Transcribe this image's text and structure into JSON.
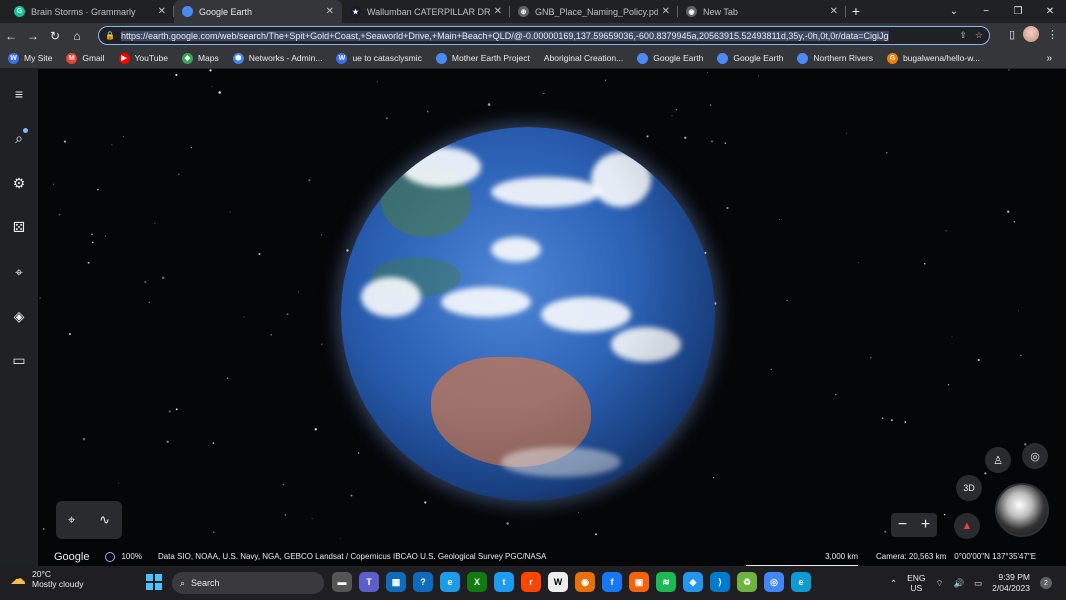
{
  "tabs": [
    {
      "title": "Brain Storms · Grammarly",
      "favicon_color": "#15c39a",
      "favicon_char": "G"
    },
    {
      "title": "Google Earth",
      "favicon_color": "#4a8af4",
      "favicon_char": "",
      "active": true
    },
    {
      "title": "Wallumban CATERPILLAR DREAM",
      "favicon_color": "#1a1a2e",
      "favicon_char": "★"
    },
    {
      "title": "GNB_Place_Naming_Policy.pdf",
      "favicon_color": "#5f6368",
      "favicon_char": "⊕"
    },
    {
      "title": "New Tab",
      "favicon_color": "#5f6368",
      "favicon_char": "◉"
    }
  ],
  "window_controls": {
    "dropdown": "⌄",
    "minimize": "−",
    "maximize": "❐",
    "close": "✕"
  },
  "toolbar": {
    "back": "←",
    "forward": "→",
    "reload": "↻",
    "home": "⌂",
    "url": "https://earth.google.com/web/search/The+Spit+Gold+Coast,+Seaworld+Drive,+Main+Beach+QLD/@-0.00000169,137.59659036,-600.8379945a,20563915.52493811d,35y,-0h,0t,0r/data=CigiJg"
  },
  "bookmarks": [
    {
      "label": "My Site",
      "color": "#3c6df0",
      "char": "W"
    },
    {
      "label": "Gmail",
      "color": "#ea4335",
      "char": "M"
    },
    {
      "label": "YouTube",
      "color": "#ff0000",
      "char": "▶"
    },
    {
      "label": "Maps",
      "color": "#34a853",
      "char": "◆"
    },
    {
      "label": "Networks - Admin...",
      "color": "#4285f4",
      "char": "⬢"
    },
    {
      "label": "ue to catasclysmic",
      "color": "#3c6df0",
      "char": "W"
    },
    {
      "label": "Mother Earth Project",
      "color": "#4a8af4",
      "char": ""
    },
    {
      "label": "Aboriginal Creation...",
      "color": "",
      "char": ""
    },
    {
      "label": "Google Earth",
      "color": "#4a8af4",
      "char": ""
    },
    {
      "label": "Google Earth",
      "color": "#4a8af4",
      "char": ""
    },
    {
      "label": "Northern Rivers",
      "color": "#4a8af4",
      "char": ""
    },
    {
      "label": "bugalwena/hello-w...",
      "color": "#f57c00",
      "char": "G"
    }
  ],
  "bookmarks_more": "»",
  "earth": {
    "status": {
      "brand": "Google",
      "load_percent": "100%",
      "attribution": "Data SIO, NOAA, U.S. Navy, NGA, GEBCO   Landsat / Copernicus   IBCAO   U.S. Geological Survey   PGC/NASA",
      "scale": "3,000 km",
      "camera": "Camera: 20,563 km",
      "coords": "0°00'00\"N 137°35'47\"E"
    },
    "buttons": {
      "view_3d": "3D",
      "zoom_out": "−",
      "zoom_in": "+"
    }
  },
  "taskbar": {
    "weather_temp": "20°C",
    "weather_desc": "Mostly cloudy",
    "search_label": "Search",
    "apps": [
      {
        "name": "file-explorer",
        "color": "#555",
        "char": "▬"
      },
      {
        "name": "teams",
        "color": "#5b5fc7",
        "char": "T"
      },
      {
        "name": "calendar",
        "color": "#0f6cbd",
        "char": "▦"
      },
      {
        "name": "help",
        "color": "#0f6cbd",
        "char": "?"
      },
      {
        "name": "edge",
        "color": "#1c9be6",
        "char": "e"
      },
      {
        "name": "xbox",
        "color": "#107c10",
        "char": "X"
      },
      {
        "name": "twitter",
        "color": "#1d9bf0",
        "char": "t"
      },
      {
        "name": "reddit",
        "color": "#ff4500",
        "char": "r"
      },
      {
        "name": "wikipedia",
        "color": "#eeeeee",
        "char": "W"
      },
      {
        "name": "chrome-alt",
        "color": "#e8710a",
        "char": "◉"
      },
      {
        "name": "facebook",
        "color": "#1877f2",
        "char": "f"
      },
      {
        "name": "photos",
        "color": "#f7630c",
        "char": "▣"
      },
      {
        "name": "spotify",
        "color": "#1db954",
        "char": "≋"
      },
      {
        "name": "docker",
        "color": "#2496ed",
        "char": "◆"
      },
      {
        "name": "vscode",
        "color": "#007acc",
        "char": "⟩"
      },
      {
        "name": "recycle",
        "color": "#6cb33f",
        "char": "♻"
      },
      {
        "name": "chrome",
        "color": "#4285f4",
        "char": "◎"
      },
      {
        "name": "edge-beta",
        "color": "#0c9bd2",
        "char": "e"
      }
    ],
    "lang": "ENG",
    "region": "US",
    "time": "9:39 PM",
    "date": "2/04/2023",
    "notifications": "2"
  }
}
